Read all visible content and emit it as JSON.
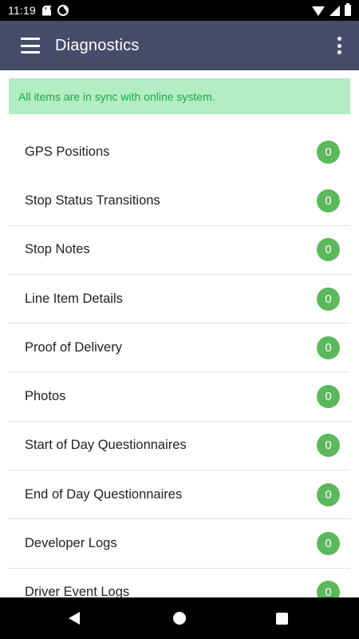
{
  "status_bar": {
    "time": "11:19",
    "icons": [
      "sd-card-icon",
      "sync-icon",
      "wifi-icon",
      "signal-icon",
      "battery-icon"
    ]
  },
  "app_bar": {
    "title": "Diagnostics",
    "background_color": "#474c6b",
    "menu_icon": "menu-icon",
    "overflow_icon": "more-vert-icon"
  },
  "banner": {
    "message": "All items are in sync with online system.",
    "background_color": "#b2edc4",
    "text_color": "#21a846"
  },
  "list": {
    "badge_color": "#5cb85c",
    "items": [
      {
        "label": "GPS Positions",
        "count": "0"
      },
      {
        "label": "Stop Status Transitions",
        "count": "0"
      },
      {
        "label": "Stop Notes",
        "count": "0"
      },
      {
        "label": "Line Item Details",
        "count": "0"
      },
      {
        "label": "Proof of Delivery",
        "count": "0"
      },
      {
        "label": "Photos",
        "count": "0"
      },
      {
        "label": "Start of Day Questionnaires",
        "count": "0"
      },
      {
        "label": "End of Day Questionnaires",
        "count": "0"
      },
      {
        "label": "Developer Logs",
        "count": "0"
      },
      {
        "label": "Driver Event Logs",
        "count": "0"
      }
    ]
  },
  "nav_bar": {
    "buttons": [
      "back-icon",
      "home-icon",
      "recents-icon"
    ]
  }
}
